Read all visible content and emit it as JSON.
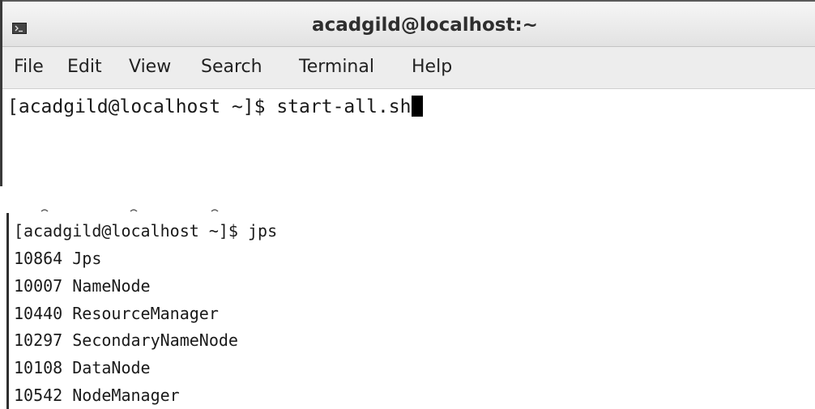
{
  "window": {
    "title": "acadgild@localhost:~",
    "icon": "terminal-icon"
  },
  "menu": {
    "items": [
      "File",
      "Edit",
      "View",
      "Search",
      "Terminal",
      "Help"
    ]
  },
  "terminal": {
    "command_line": "[acadgild@localhost ~]$ start-all.sh"
  },
  "output": {
    "prompt": "[acadgild@localhost ~]$ jps",
    "processes": [
      {
        "pid": "10864",
        "name": "Jps"
      },
      {
        "pid": "10007",
        "name": "NameNode"
      },
      {
        "pid": "10440",
        "name": "ResourceManager"
      },
      {
        "pid": "10297",
        "name": "SecondaryNameNode"
      },
      {
        "pid": "10108",
        "name": "DataNode"
      },
      {
        "pid": "10542",
        "name": "NodeManager"
      }
    ]
  }
}
